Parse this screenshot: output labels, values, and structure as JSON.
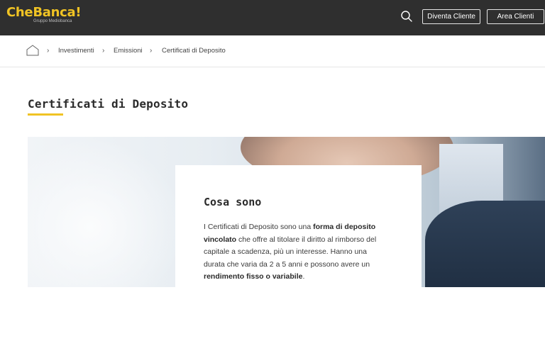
{
  "header": {
    "logo_text": "CheBanca!",
    "logo_sub": "Gruppo Mediobanca",
    "search_icon": "search-icon",
    "btn_diventa": "Diventa Cliente",
    "btn_area": "Area Clienti",
    "bg_color": "#2f2f2f",
    "brand_color": "#f0c324"
  },
  "breadcrumb": {
    "home_icon": "home-icon",
    "items": [
      "Investimenti",
      "Emissioni",
      "Certificati di Deposito"
    ],
    "separator": "›"
  },
  "page": {
    "title": "Certificati di Deposito"
  },
  "card": {
    "title": "Cosa sono",
    "text_1": "I Certificati di Deposito sono una ",
    "text_2": "forma di deposito vincolato",
    "text_3": " che offre al titolare il diritto al rimborso del capitale a scadenza, più un interesse. Hanno una durata che varia da 2 a 5 anni e possono avere un ",
    "text_4": "rendimento fisso o variabile",
    "text_5": "."
  }
}
